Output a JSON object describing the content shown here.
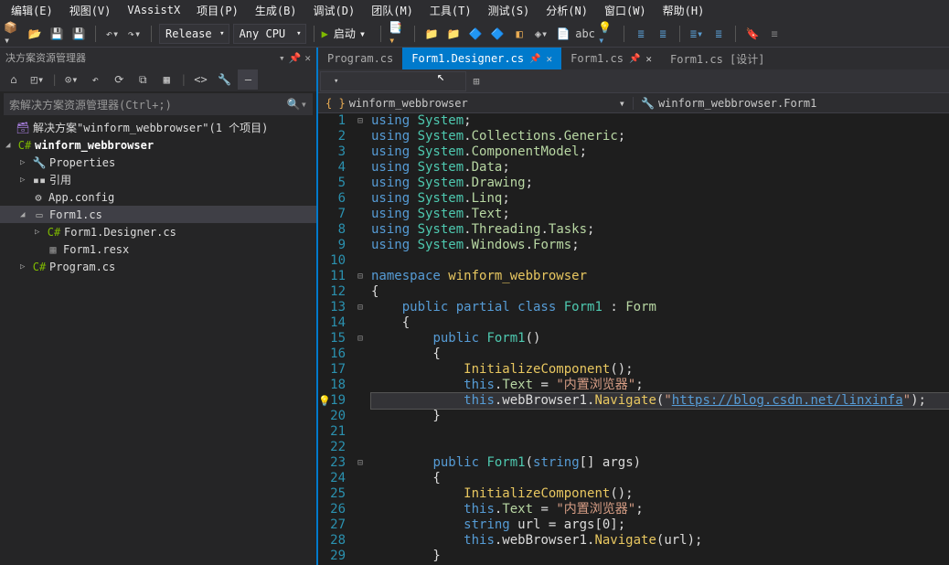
{
  "menu": [
    "编辑(E)",
    "视图(V)",
    "VAssistX",
    "项目(P)",
    "生成(B)",
    "调试(D)",
    "团队(M)",
    "工具(T)",
    "测试(S)",
    "分析(N)",
    "窗口(W)",
    "帮助(H)"
  ],
  "toolbar": {
    "config": "Release",
    "platform": "Any CPU",
    "launch": "启动"
  },
  "sidebar": {
    "title": "决方案资源管理器",
    "search_placeholder": "索解决方案资源管理器(Ctrl+;)",
    "solution": "解决方案\"winform_webbrowser\"(1 个项目)",
    "project": "winform_webbrowser",
    "items": {
      "properties": "Properties",
      "references": "引用",
      "appconfig": "App.config",
      "form1": "Form1.cs",
      "form1designer": "Form1.Designer.cs",
      "form1resx": "Form1.resx",
      "program": "Program.cs"
    }
  },
  "tabs": [
    {
      "label": "Program.cs",
      "active": false,
      "pin": false,
      "close": false
    },
    {
      "label": "Form1.Designer.cs",
      "active": true,
      "pin": true,
      "close": true
    },
    {
      "label": "Form1.cs",
      "active": false,
      "pin": true,
      "close": true
    },
    {
      "label": "Form1.cs [设计]",
      "active": false,
      "pin": false,
      "close": false
    }
  ],
  "crumbs": {
    "namespace": "winform_webbrowser",
    "class": "winform_webbrowser.Form1"
  },
  "code": {
    "lines": [
      {
        "n": 1,
        "fold": "⊟",
        "tokens": [
          [
            "kw",
            "using "
          ],
          [
            "type",
            "System"
          ],
          [
            "txt",
            ";"
          ]
        ]
      },
      {
        "n": 2,
        "tokens": [
          [
            "kw",
            "using "
          ],
          [
            "type",
            "System"
          ],
          [
            "txt",
            "."
          ],
          [
            "itf",
            "Collections"
          ],
          [
            "txt",
            "."
          ],
          [
            "itf",
            "Generic"
          ],
          [
            "txt",
            ";"
          ]
        ]
      },
      {
        "n": 3,
        "tokens": [
          [
            "kw",
            "using "
          ],
          [
            "type",
            "System"
          ],
          [
            "txt",
            "."
          ],
          [
            "itf",
            "ComponentModel"
          ],
          [
            "txt",
            ";"
          ]
        ]
      },
      {
        "n": 4,
        "tokens": [
          [
            "kw",
            "using "
          ],
          [
            "type",
            "System"
          ],
          [
            "txt",
            "."
          ],
          [
            "itf",
            "Data"
          ],
          [
            "txt",
            ";"
          ]
        ]
      },
      {
        "n": 5,
        "tokens": [
          [
            "kw",
            "using "
          ],
          [
            "type",
            "System"
          ],
          [
            "txt",
            "."
          ],
          [
            "itf",
            "Drawing"
          ],
          [
            "txt",
            ";"
          ]
        ]
      },
      {
        "n": 6,
        "tokens": [
          [
            "kw",
            "using "
          ],
          [
            "type",
            "System"
          ],
          [
            "txt",
            "."
          ],
          [
            "itf",
            "Linq"
          ],
          [
            "txt",
            ";"
          ]
        ]
      },
      {
        "n": 7,
        "tokens": [
          [
            "kw",
            "using "
          ],
          [
            "type",
            "System"
          ],
          [
            "txt",
            "."
          ],
          [
            "itf",
            "Text"
          ],
          [
            "txt",
            ";"
          ]
        ]
      },
      {
        "n": 8,
        "tokens": [
          [
            "kw",
            "using "
          ],
          [
            "type",
            "System"
          ],
          [
            "txt",
            "."
          ],
          [
            "itf",
            "Threading"
          ],
          [
            "txt",
            "."
          ],
          [
            "itf",
            "Tasks"
          ],
          [
            "txt",
            ";"
          ]
        ]
      },
      {
        "n": 9,
        "tokens": [
          [
            "kw",
            "using "
          ],
          [
            "type",
            "System"
          ],
          [
            "txt",
            "."
          ],
          [
            "itf",
            "Windows"
          ],
          [
            "txt",
            "."
          ],
          [
            "itf",
            "Forms"
          ],
          [
            "txt",
            ";"
          ]
        ]
      },
      {
        "n": 10,
        "tokens": []
      },
      {
        "n": 11,
        "fold": "⊟",
        "tokens": [
          [
            "kw",
            "namespace "
          ],
          [
            "ns",
            "winform_webbrowser"
          ]
        ]
      },
      {
        "n": 12,
        "tokens": [
          [
            "txt",
            "{"
          ]
        ]
      },
      {
        "n": 13,
        "fold": "⊟",
        "tokens": [
          [
            "txt",
            "    "
          ],
          [
            "kw",
            "public partial class "
          ],
          [
            "type",
            "Form1"
          ],
          [
            "txt",
            " : "
          ],
          [
            "itf",
            "Form"
          ]
        ]
      },
      {
        "n": 14,
        "tokens": [
          [
            "txt",
            "    {"
          ]
        ]
      },
      {
        "n": 15,
        "fold": "⊟",
        "tokens": [
          [
            "txt",
            "        "
          ],
          [
            "kw",
            "public "
          ],
          [
            "type",
            "Form1"
          ],
          [
            "txt",
            "()"
          ]
        ]
      },
      {
        "n": 16,
        "tokens": [
          [
            "txt",
            "        {"
          ]
        ]
      },
      {
        "n": 17,
        "tokens": [
          [
            "txt",
            "            "
          ],
          [
            "meth",
            "InitializeComponent"
          ],
          [
            "txt",
            "();"
          ]
        ]
      },
      {
        "n": 18,
        "tokens": [
          [
            "txt",
            "            "
          ],
          [
            "kw",
            "this"
          ],
          [
            "txt",
            "."
          ],
          [
            "prop",
            "Text"
          ],
          [
            "txt",
            " = "
          ],
          [
            "str",
            "\"内置浏览器\""
          ],
          [
            "txt",
            ";"
          ]
        ]
      },
      {
        "n": 19,
        "hl": true,
        "bulb": true,
        "tokens": [
          [
            "txt",
            "            "
          ],
          [
            "kw",
            "this"
          ],
          [
            "txt",
            ".webBrowser1."
          ],
          [
            "meth",
            "Navigate"
          ],
          [
            "txt",
            "("
          ],
          [
            "str",
            "\""
          ],
          [
            "url",
            "https://blog.csdn.net/linxinfa"
          ],
          [
            "str",
            "\""
          ],
          [
            "txt",
            ");"
          ]
        ]
      },
      {
        "n": 20,
        "tokens": [
          [
            "txt",
            "        }"
          ]
        ]
      },
      {
        "n": 21,
        "tokens": []
      },
      {
        "n": 22,
        "tokens": []
      },
      {
        "n": 23,
        "fold": "⊟",
        "tokens": [
          [
            "txt",
            "        "
          ],
          [
            "kw",
            "public "
          ],
          [
            "type",
            "Form1"
          ],
          [
            "txt",
            "("
          ],
          [
            "kw",
            "string"
          ],
          [
            "txt",
            "[] args)"
          ]
        ]
      },
      {
        "n": 24,
        "tokens": [
          [
            "txt",
            "        {"
          ]
        ]
      },
      {
        "n": 25,
        "tokens": [
          [
            "txt",
            "            "
          ],
          [
            "meth",
            "InitializeComponent"
          ],
          [
            "txt",
            "();"
          ]
        ]
      },
      {
        "n": 26,
        "tokens": [
          [
            "txt",
            "            "
          ],
          [
            "kw",
            "this"
          ],
          [
            "txt",
            "."
          ],
          [
            "prop",
            "Text"
          ],
          [
            "txt",
            " = "
          ],
          [
            "str",
            "\"内置浏览器\""
          ],
          [
            "txt",
            ";"
          ]
        ]
      },
      {
        "n": 27,
        "tokens": [
          [
            "txt",
            "            "
          ],
          [
            "kw",
            "string"
          ],
          [
            "txt",
            " url = args[0];"
          ]
        ]
      },
      {
        "n": 28,
        "tokens": [
          [
            "txt",
            "            "
          ],
          [
            "kw",
            "this"
          ],
          [
            "txt",
            ".webBrowser1."
          ],
          [
            "meth",
            "Navigate"
          ],
          [
            "txt",
            "(url);"
          ]
        ]
      },
      {
        "n": 29,
        "tokens": [
          [
            "txt",
            "        }"
          ]
        ]
      }
    ]
  }
}
